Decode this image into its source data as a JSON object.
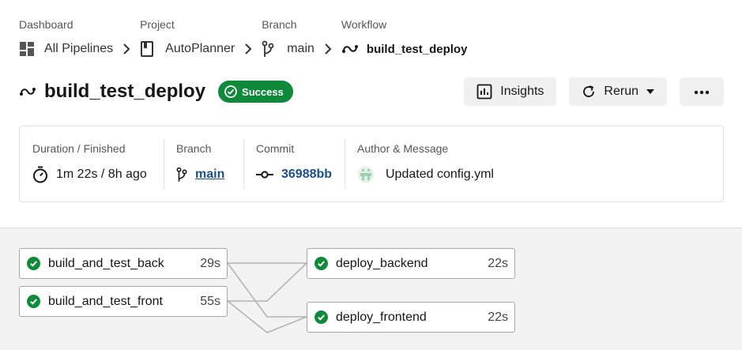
{
  "breadcrumbs": [
    {
      "label": "Dashboard",
      "value": "All Pipelines"
    },
    {
      "label": "Project",
      "value": "AutoPlanner"
    },
    {
      "label": "Branch",
      "value": "main"
    },
    {
      "label": "Workflow",
      "value": "build_test_deploy"
    }
  ],
  "header": {
    "title": "build_test_deploy",
    "status": "Success",
    "insights_label": "Insights",
    "rerun_label": "Rerun"
  },
  "summary": {
    "duration": {
      "label": "Duration / Finished",
      "value": "1m 22s / 8h ago"
    },
    "branch": {
      "label": "Branch",
      "value": "main"
    },
    "commit": {
      "label": "Commit",
      "value": "36988bb"
    },
    "author": {
      "label": "Author & Message",
      "value": "Updated config.yml"
    }
  },
  "jobs": [
    {
      "name": "build_and_test_back",
      "duration": "29s",
      "status": "success"
    },
    {
      "name": "build_and_test_front",
      "duration": "55s",
      "status": "success"
    },
    {
      "name": "deploy_backend",
      "duration": "22s",
      "status": "success"
    },
    {
      "name": "deploy_frontend",
      "duration": "22s",
      "status": "success"
    }
  ],
  "colors": {
    "success": "#0f8a3b",
    "link": "#1a4f8f"
  },
  "icons": {
    "dashboard": "dashboard-icon",
    "project": "project-icon",
    "branch": "branch-icon",
    "workflow": "workflow-icon",
    "success": "check-circle-icon",
    "insights": "insights-chart-icon",
    "rerun": "rerun-icon",
    "more": "more-dots-icon",
    "timer": "timer-icon",
    "commit": "commit-icon",
    "avatar": "avatar-icon"
  }
}
